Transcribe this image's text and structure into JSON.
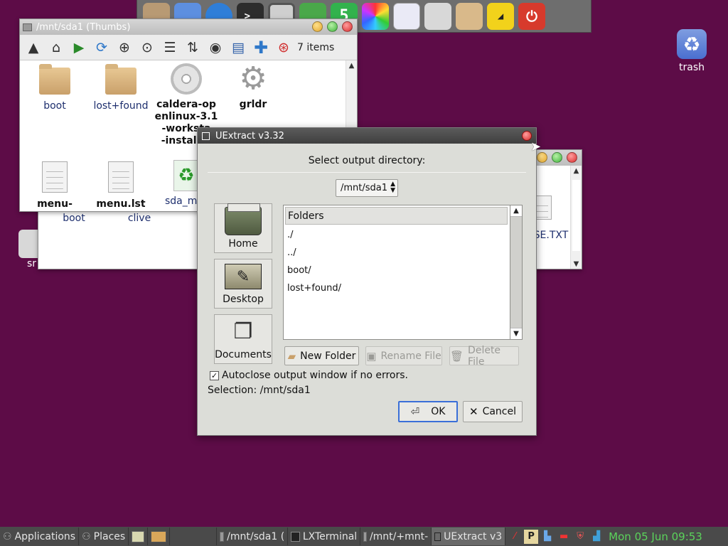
{
  "dock": {
    "icons": [
      "folder-icon",
      "cloud-icon",
      "browser-icon",
      "terminal-icon",
      "monitor-icon",
      "text-editor-icon",
      "html5-icon",
      "color-picker-icon",
      "document-icon",
      "mixer-icon",
      "box-icon",
      "volume-icon",
      "power-icon"
    ],
    "terminal_glyph": ">_"
  },
  "desktop": {
    "trash_label": "trash",
    "partial_label": "sr"
  },
  "fm_back": {
    "items": [
      {
        "name": "boot",
        "type": "folder"
      },
      {
        "name": "clive",
        "type": "folder"
      },
      {
        "name": "SE.TXT",
        "type": "document"
      }
    ]
  },
  "fm_front": {
    "title": "/mnt/sda1 (Thumbs)",
    "items_count": "7 items",
    "toolbar_icons": [
      "up-arrow-icon",
      "home-icon",
      "play-icon",
      "refresh-icon",
      "zoom-in-icon",
      "zoom-fit-icon",
      "list-view-icon",
      "sort-icon",
      "eye-icon",
      "details-icon",
      "add-icon",
      "help-icon"
    ],
    "files": [
      {
        "name": "boot",
        "type": "folder",
        "bold": false
      },
      {
        "name": "lost+found",
        "type": "folder",
        "bold": false
      },
      {
        "name": "caldera-openlinux-3.1-worksta\n-install...",
        "type": "disc",
        "bold": true
      },
      {
        "name": "grldr",
        "type": "gear",
        "bold": true
      },
      {
        "name": "menu-2023-",
        "type": "document",
        "bold": true
      },
      {
        "name": "menu.lst",
        "type": "document",
        "bold": true
      },
      {
        "name": "sda_mbr",
        "type": "recycle",
        "bold": false
      }
    ]
  },
  "dialog": {
    "title": "UExtract v3.32",
    "prompt": "Select output directory:",
    "dir_value": "/mnt/sda1",
    "places": [
      {
        "label": "Home",
        "icon": "home-folder-icon"
      },
      {
        "label": "Desktop",
        "icon": "desktop-icon"
      },
      {
        "label": "Documents",
        "icon": "documents-icon"
      }
    ],
    "list_header": "Folders",
    "folders": [
      "./",
      "../",
      "boot/",
      "lost+found/"
    ],
    "new_folder": "New Folder",
    "rename_file": "Rename File",
    "delete_file": "Delete File",
    "autoclose_label": "Autoclose output window if no errors.",
    "autoclose_checked": true,
    "selection": "Selection: /mnt/sda1",
    "ok": "OK",
    "cancel": "Cancel"
  },
  "taskbar": {
    "applications": "Applications",
    "places": "Places",
    "tasks": [
      {
        "label": "/mnt/sda1 (",
        "active": false
      },
      {
        "label": "LXTerminal",
        "active": false
      },
      {
        "label": "/mnt/+mnt-",
        "active": false
      },
      {
        "label": "UExtract v3",
        "active": true
      }
    ],
    "clock": "Mon 05 Jun 09:53"
  }
}
